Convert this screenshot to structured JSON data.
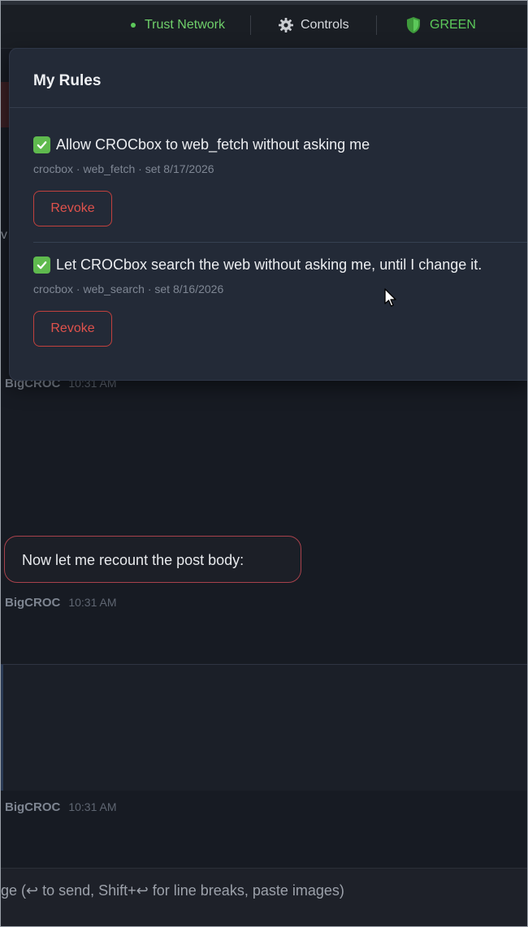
{
  "topbar": {
    "trust_label": "Trust Network",
    "controls_label": "Controls",
    "status_label": "GREEN",
    "trust_color": "#6fcf6a",
    "status_color": "#5cc85a"
  },
  "rules_popup": {
    "title": "My Rules",
    "rules": [
      {
        "title": "Allow CROCbox to web_fetch without asking me",
        "meta": "crocbox · web_fetch · set 8/17/2026",
        "revoke_label": "Revoke"
      },
      {
        "title": "Let CROCbox search the web without asking me, until I change it.",
        "meta": "crocbox · web_search · set 8/16/2026",
        "revoke_label": "Revoke"
      }
    ]
  },
  "chat": {
    "messages": [
      {
        "author": "BigCROC",
        "time": "10:31 AM"
      },
      {
        "author": "BigCROC",
        "time": "10:31 AM",
        "text": "Now let me recount the post body:"
      },
      {
        "author": "BigCROC",
        "time": "10:31 AM"
      }
    ],
    "partial_left_char": "v"
  },
  "composer": {
    "placeholder": "ge (↩ to send, Shift+↩ for line breaks, paste images)"
  }
}
